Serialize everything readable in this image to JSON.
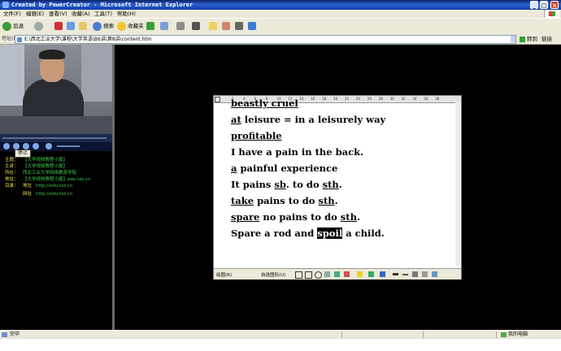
{
  "window": {
    "title": "Created by PowerCreator - Microsoft Internet Explorer",
    "minimize": "_",
    "maximize": "□",
    "close": "×"
  },
  "menu": [
    "文件(F)",
    "编辑(E)",
    "查看(V)",
    "收藏(A)",
    "工具(T)",
    "帮助(H)"
  ],
  "toolbar": {
    "back_label": "后退",
    "search_label": "搜索",
    "favorites_label": "收藏夹"
  },
  "address": {
    "label": "地址(D)",
    "value": "E:\\西北工业大学\\课程\\大学英语\\B6讲\\第8讲\\content.htm",
    "go_label": "转到",
    "links_label": "链接"
  },
  "player": {
    "stop_label": "停止"
  },
  "info": [
    {
      "key": "主题：",
      "value": "【大学视频教程小屋】"
    },
    {
      "key": "主讲：",
      "value": "【大学视频教程小屋】"
    },
    {
      "key": "所在：",
      "value": "西北工业大学网络教育学院"
    },
    {
      "key": "地址：",
      "value": "【大学视频教程小屋】edu.tzz.cn"
    },
    {
      "key": "目录：",
      "value": "地址",
      "value2": "http://edu.tzz.cn"
    },
    {
      "key": "",
      "value": "网址",
      "value2": "http://edu.tzz.cn"
    }
  ],
  "document": {
    "lines": [
      {
        "parts": [
          {
            "t": "beastly  cruel",
            "u": true
          }
        ]
      },
      {
        "parts": [
          {
            "t": "at",
            "u": true
          },
          {
            "t": " leisure = in a leisurely way"
          }
        ]
      },
      {
        "parts": [
          {
            "t": "profitable",
            "u": true
          }
        ]
      },
      {
        "parts": [
          {
            "t": "I have a pain in the back."
          }
        ]
      },
      {
        "parts": [
          {
            "t": "a",
            "u": true
          },
          {
            "t": " painful experience"
          }
        ]
      },
      {
        "parts": [
          {
            "t": "It pains "
          },
          {
            "t": "sb",
            "u": true
          },
          {
            "t": ". to do "
          },
          {
            "t": "sth",
            "u": true
          },
          {
            "t": "."
          }
        ]
      },
      {
        "parts": [
          {
            "t": "take",
            "u": true
          },
          {
            "t": " pains to do "
          },
          {
            "t": "sth",
            "u": true
          },
          {
            "t": "."
          }
        ]
      },
      {
        "parts": [
          {
            "t": "spare",
            "u": true
          },
          {
            "t": " no pains to do "
          },
          {
            "t": "sth",
            "u": true
          },
          {
            "t": "."
          }
        ]
      },
      {
        "parts": [
          {
            "t": "Spare a rod and "
          },
          {
            "t": "spoil",
            "h": true
          },
          {
            "t": " a child."
          }
        ]
      }
    ],
    "ruler_ticks": [
      "2",
      "4",
      "6",
      "8",
      "10",
      "12",
      "14",
      "16",
      "18",
      "20",
      "22",
      "24",
      "26",
      "28",
      "30",
      "32",
      "34",
      "36",
      "38"
    ],
    "draw_label": "绘图(R)",
    "autoshape_label": "自选图形(U)"
  },
  "status": {
    "left": "完毕",
    "right": "我的电脑"
  }
}
